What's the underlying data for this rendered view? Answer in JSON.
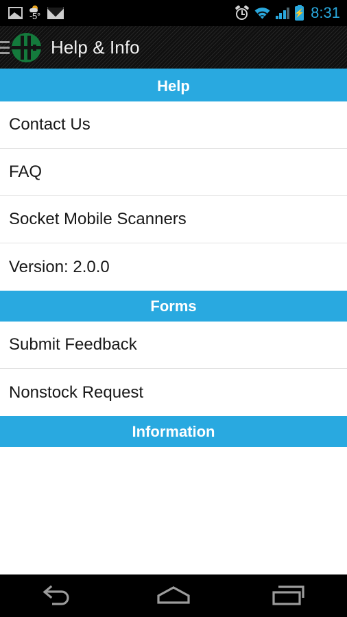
{
  "status_bar": {
    "icons_left": [
      "gallery-icon",
      "weather-icon",
      "mail-icon"
    ],
    "weather_temp": "-5°",
    "icons_right": [
      "alarm-icon",
      "wifi-icon",
      "signal-icon",
      "battery-charging-icon"
    ],
    "clock": "8:31",
    "clock_color": "#2aa8dd"
  },
  "action_bar": {
    "drawer_icon": "hamburger-menu-icon",
    "logo_icon": "app-logo-icon",
    "logo_color": "#147a3c",
    "title": "Help & Info",
    "accent_color": "#29a9e0"
  },
  "sections": [
    {
      "header": "Help",
      "items": [
        {
          "label": "Contact Us"
        },
        {
          "label": "FAQ"
        },
        {
          "label": "Socket Mobile Scanners"
        },
        {
          "label": "Version: 2.0.0"
        }
      ]
    },
    {
      "header": "Forms",
      "items": [
        {
          "label": "Submit Feedback"
        },
        {
          "label": "Nonstock Request"
        }
      ]
    },
    {
      "header": "Information",
      "items": []
    }
  ],
  "nav_bar": {
    "back": "back-icon",
    "home": "home-icon",
    "recents": "recents-icon"
  },
  "colors": {
    "section_blue": "#29a9e0",
    "list_text": "#181818",
    "divider": "#e2e2e2",
    "bar_dark": "#1c1c1c"
  }
}
